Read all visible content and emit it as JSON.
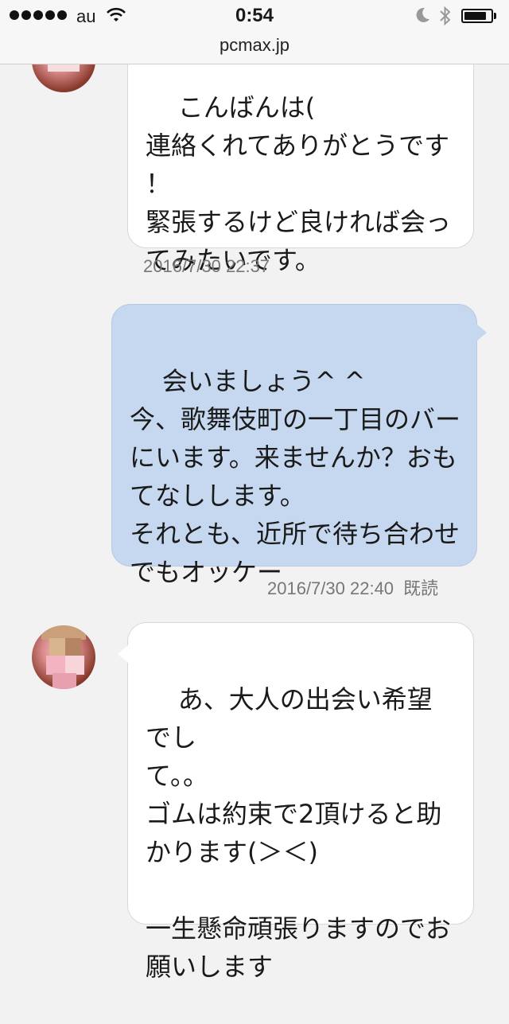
{
  "status_bar": {
    "carrier": "au",
    "time": "0:54",
    "battery_level": 0.85
  },
  "url_bar": {
    "domain": "pcmax.jp"
  },
  "messages": [
    {
      "direction": "incoming",
      "text": "こんばんは(\n連絡くれてありがとうです\n！\n緊張するけど良ければ会っ\nてみたいです。",
      "timestamp": "2016/7/30 22:37"
    },
    {
      "direction": "outgoing",
      "text": "会いましょう^ ^\n今、歌舞伎町の一丁目のバー\nにいます。来ませんか？おも\nてなしします。\nそれとも、近所で待ち合わせ\nでもオッケー",
      "timestamp": "2016/7/30 22:40",
      "read_status": "既読"
    },
    {
      "direction": "incoming",
      "text": "あ、大人の出会い希望でし\nて。。\nゴムは約束で2頂けると助\nかります(＞＜)\n\n一生懸命頑張りますのでお\n願いします"
    }
  ],
  "colors": {
    "incoming_bubble": "#ffffff",
    "outgoing_bubble": "#c6d8ef",
    "background": "#f2f2f2"
  }
}
